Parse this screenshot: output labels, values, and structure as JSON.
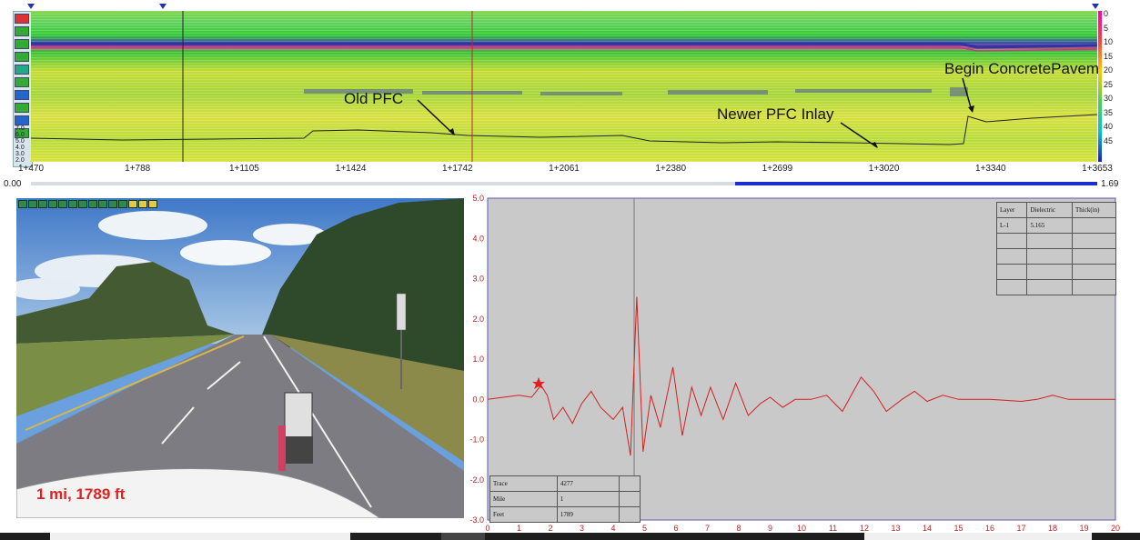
{
  "radargram": {
    "distance_ticks": [
      "1+470",
      "1+788",
      "1+1105",
      "1+1424",
      "1+1742",
      "1+2061",
      "1+2380",
      "1+2699",
      "1+3020",
      "1+3340",
      "1+3653"
    ],
    "depth_scale": [
      "0",
      "5",
      "10",
      "15",
      "20",
      "25",
      "30",
      "35",
      "40",
      "45"
    ],
    "amplitude_scale": [
      "7.0",
      "6.0",
      "5.0",
      "4.0",
      "3.0",
      "2.0"
    ],
    "annotations": {
      "old_pfc": "Old PFC",
      "newer_pfc": "Newer PFC Inlay",
      "concrete": "Begin ConcretePavem"
    }
  },
  "scrollbar": {
    "start_label": "0.00",
    "end_label": "1.69",
    "thumb_start": 0.66,
    "thumb_end": 1.0
  },
  "camera": {
    "overlay_text": "1 mi, 1789 ft",
    "toolbar_icons": [
      "first-icon",
      "prev-icon",
      "play-back-icon",
      "stop-icon",
      "play-icon",
      "next-icon",
      "last-icon",
      "slow-icon",
      "fast-icon",
      "loop-icon",
      "snap-icon",
      "config-icon",
      "zoom-in-icon",
      "zoom-out-icon"
    ]
  },
  "waveform": {
    "y_ticks": [
      "5.0",
      "4.0",
      "3.0",
      "2.0",
      "1.0",
      "0.0",
      "-1.0",
      "-2.0",
      "-3.0"
    ],
    "x_ticks": [
      "0",
      "1",
      "2",
      "3",
      "4",
      "5",
      "6",
      "7",
      "8",
      "9",
      "10",
      "11",
      "12",
      "13",
      "14",
      "15",
      "16",
      "17",
      "18",
      "19",
      "20"
    ],
    "layer_table": {
      "headers": [
        "Layer",
        "Dielectric",
        "Thick(in)"
      ],
      "rows": [
        [
          "L-1",
          "5.165",
          ""
        ],
        [
          "",
          "",
          ""
        ],
        [
          "",
          "",
          ""
        ],
        [
          "",
          "",
          ""
        ],
        [
          "",
          "",
          ""
        ]
      ]
    },
    "info_table": [
      {
        "label": "Trace",
        "value": "4277"
      },
      {
        "label": "Mile",
        "value": "1"
      },
      {
        "label": "Feet",
        "value": "1789"
      }
    ],
    "colors": {
      "trace": "#d42020",
      "background": "#c9c9c9",
      "cursor": "#777777"
    }
  },
  "colorbar": {
    "top": "#ff00aa",
    "bottom": "#1a1ad0"
  }
}
